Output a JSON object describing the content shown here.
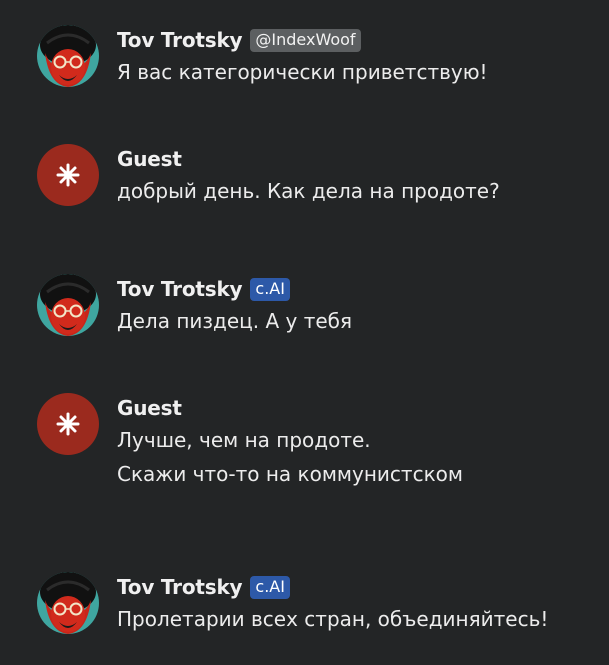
{
  "messages": [
    {
      "author": "Tov Trotsky",
      "badge": "@IndexWoof",
      "badge_kind": "handle",
      "avatar": "trotsky-avatar",
      "lines": [
        "Я вас категорически приветствую!"
      ]
    },
    {
      "author": "Guest",
      "badge": null,
      "avatar": "guest-avatar",
      "lines": [
        "добрый день. Как дела на продоте?"
      ]
    },
    {
      "author": "Tov Trotsky",
      "badge": "c.AI",
      "badge_kind": "ai",
      "avatar": "trotsky-avatar",
      "lines": [
        "Дела пиздец. А у тебя"
      ]
    },
    {
      "author": "Guest",
      "badge": null,
      "avatar": "guest-avatar",
      "lines": [
        "Лучше, чем на продоте.",
        "Скажи что-то на коммунистском"
      ]
    },
    {
      "author": "Tov Trotsky",
      "badge": "c.AI",
      "badge_kind": "ai",
      "avatar": "trotsky-avatar",
      "lines": [
        "Пролетарии всех стран, объединяйтесь!"
      ]
    }
  ],
  "colors": {
    "background": "#232526",
    "guest_avatar": "#9b2a1e",
    "ai_badge": "#2d59a8",
    "handle_badge": "#5c5f61"
  }
}
